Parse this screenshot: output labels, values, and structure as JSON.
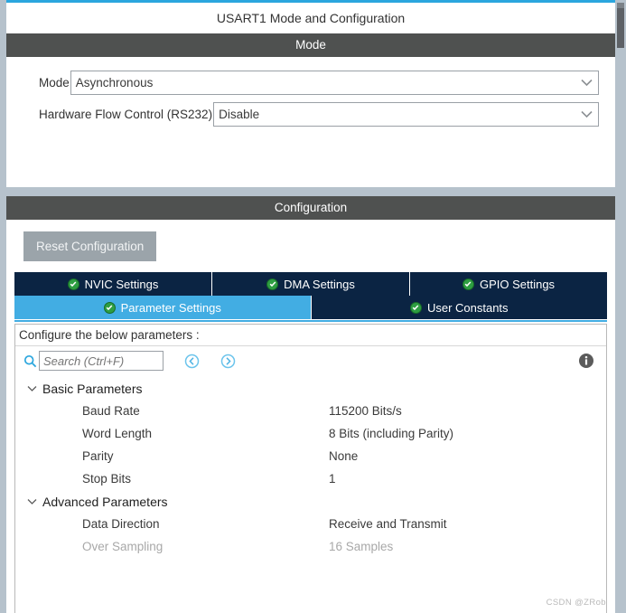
{
  "window": {
    "title": "USART1 Mode and Configuration"
  },
  "mode_section": {
    "header": "Mode",
    "fields": [
      {
        "label": "Mode",
        "value": "Asynchronous",
        "arrow_icon": "chevron-down-icon"
      },
      {
        "label": "Hardware Flow Control (RS232)",
        "value": "Disable",
        "arrow_icon": "chevron-down-icon"
      }
    ]
  },
  "configuration_section": {
    "header": "Configuration",
    "reset_button": "Reset Configuration",
    "tabs_row1": [
      {
        "label": "NVIC Settings",
        "icon": "green-check-icon",
        "active": false
      },
      {
        "label": "DMA Settings",
        "icon": "green-check-icon",
        "active": false
      },
      {
        "label": "GPIO Settings",
        "icon": "green-check-icon",
        "active": false
      }
    ],
    "tabs_row2": [
      {
        "label": "Parameter Settings",
        "icon": "green-check-icon",
        "active": true
      },
      {
        "label": "User Constants",
        "icon": "green-check-icon",
        "active": false
      }
    ],
    "configure_hint": "Configure the below parameters :",
    "search": {
      "placeholder": "Search (Ctrl+F)",
      "value": "",
      "icon": "search-icon",
      "prev_icon": "previous-circle-icon",
      "next_icon": "next-circle-icon",
      "info_icon": "info-icon"
    },
    "groups": [
      {
        "label": "Basic Parameters",
        "expanded": true,
        "twisty_icon": "chevron-down-icon",
        "rows": [
          {
            "name": "Baud Rate",
            "value": "115200 Bits/s",
            "disabled": false
          },
          {
            "name": "Word Length",
            "value": "8 Bits (including Parity)",
            "disabled": false
          },
          {
            "name": "Parity",
            "value": "None",
            "disabled": false
          },
          {
            "name": "Stop Bits",
            "value": "1",
            "disabled": false
          }
        ]
      },
      {
        "label": "Advanced Parameters",
        "expanded": true,
        "twisty_icon": "chevron-down-icon",
        "rows": [
          {
            "name": "Data Direction",
            "value": "Receive and Transmit",
            "disabled": false
          },
          {
            "name": "Over Sampling",
            "value": "16 Samples",
            "disabled": true
          }
        ]
      }
    ]
  },
  "watermark": "CSDN @ZRob",
  "colors": {
    "accent_blue": "#2ba6de",
    "tab_active": "#42ade3",
    "tab_inactive": "#0b2443",
    "section_bar": "#4f5150",
    "frame": "#b6c2cc",
    "check_green": "#2e9e42"
  }
}
